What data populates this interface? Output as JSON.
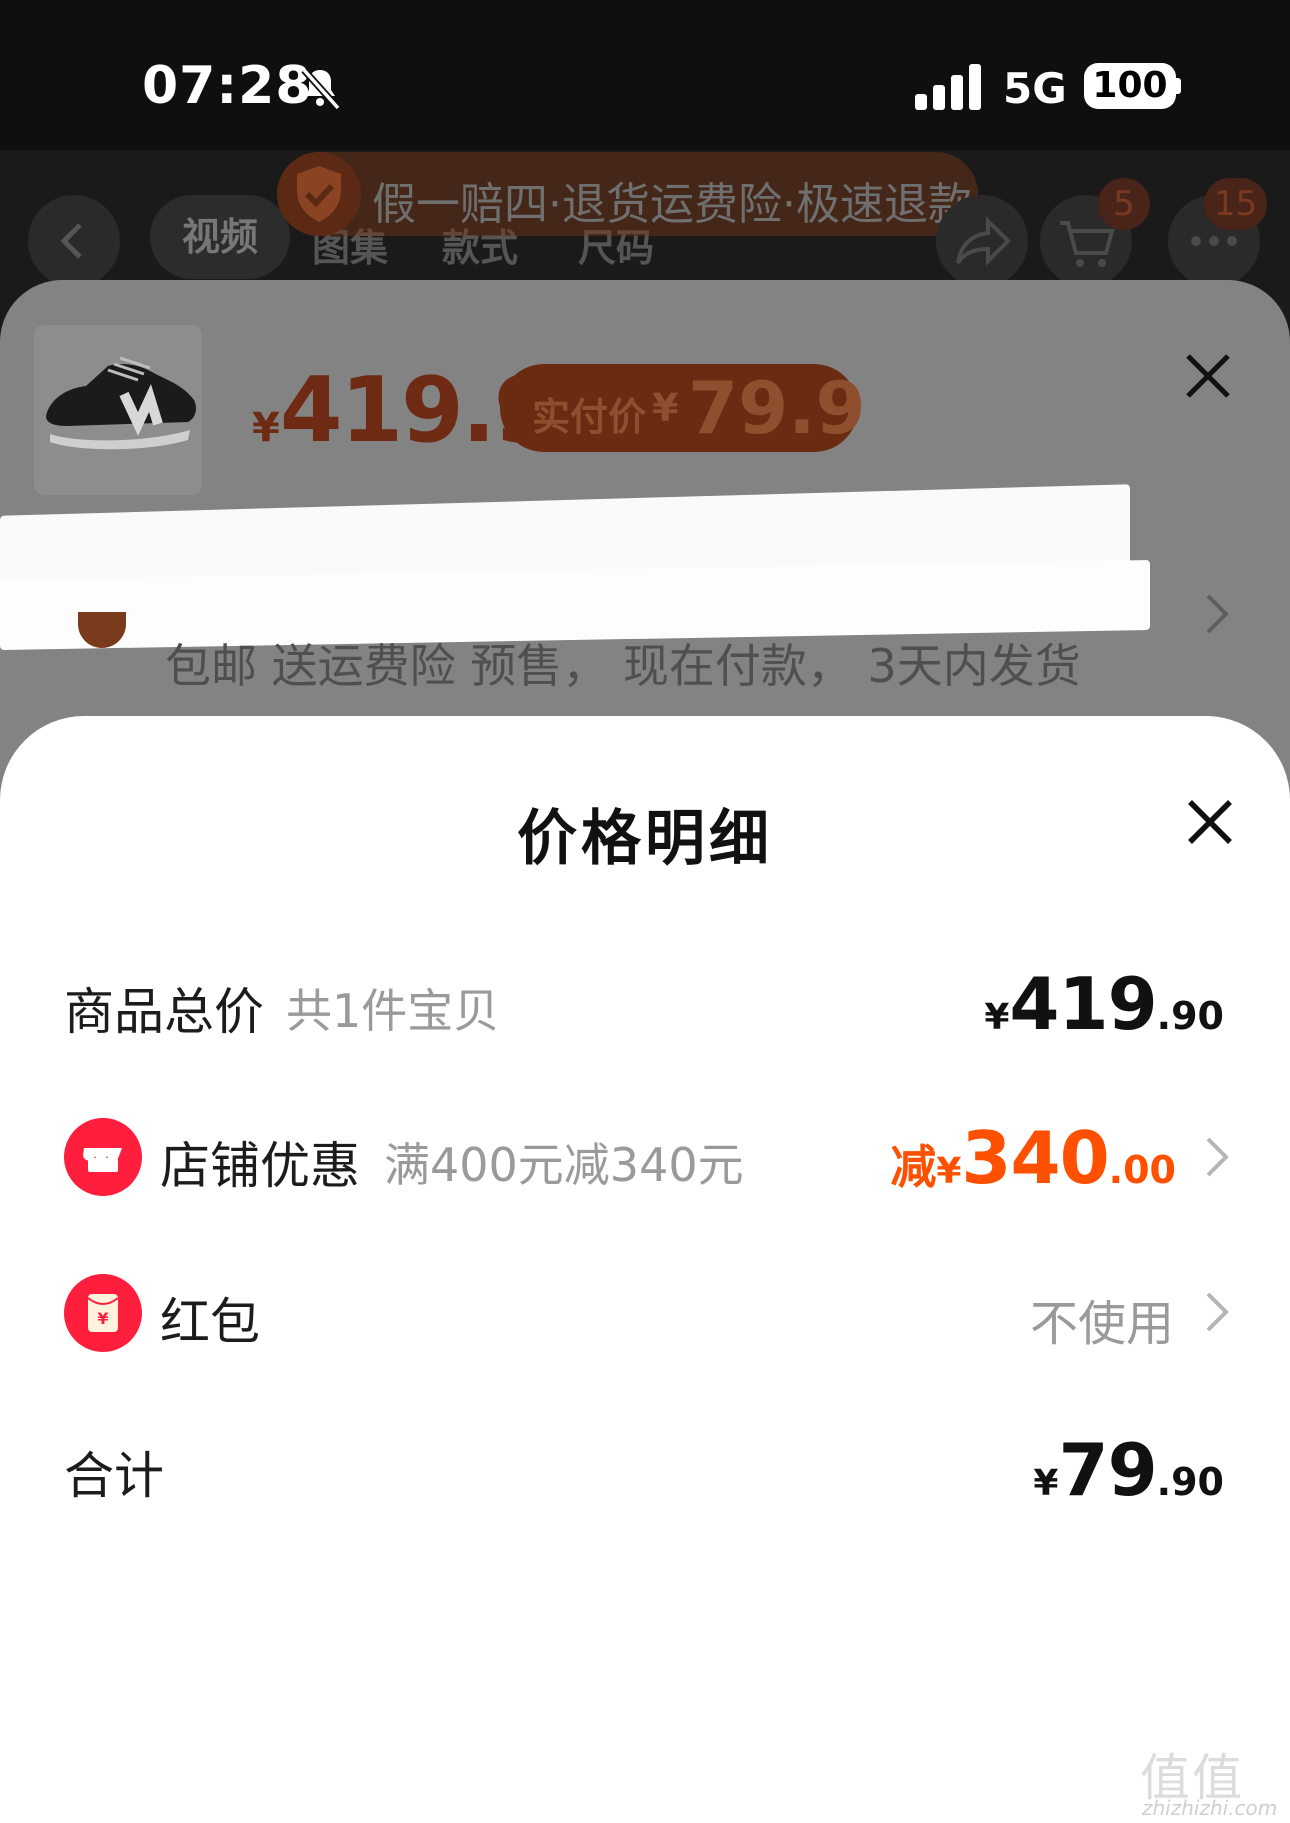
{
  "status_bar": {
    "time": "07:28",
    "network": "5G",
    "battery": "100"
  },
  "header": {
    "trust_banner": "假一赔四·退货运费险·极速退款",
    "tabs": [
      "视频",
      "图集",
      "款式",
      "尺码"
    ],
    "cart_badge": "5",
    "more_badge": "15"
  },
  "sku_panel": {
    "currency_symbol": "¥",
    "price": "419.9",
    "pay_label": "实付价",
    "pay_value": "79.9",
    "service_text": "包邮  送运费险  预售， 现在付款， 3天内发货"
  },
  "price_detail": {
    "title": "价格明细",
    "rows": [
      {
        "label": "商品总价",
        "sub": "共1件宝贝",
        "currency": "¥",
        "integer": "419",
        "decimal": ".90"
      },
      {
        "label": "店铺优惠",
        "sub": "满400元减340元",
        "prefix": "减",
        "currency": "¥",
        "integer": "340",
        "decimal": ".00"
      },
      {
        "label": "红包",
        "value": "不使用"
      },
      {
        "label": "合计",
        "currency": "¥",
        "integer": "79",
        "decimal": ".90"
      }
    ]
  },
  "watermark": {
    "glyphs": "值值值",
    "url": "zhizhizhi.com"
  },
  "colors": {
    "accent": "#ff5000",
    "icon_red": "#ff1f3d",
    "muted": "#9a9a9a"
  },
  "icons": [
    "bell-slash-icon",
    "signal-icon",
    "shield-check-icon",
    "back-icon",
    "share-icon",
    "cart-icon",
    "more-icon",
    "close-icon",
    "store-icon",
    "red-packet-icon",
    "chevron-right-icon"
  ]
}
